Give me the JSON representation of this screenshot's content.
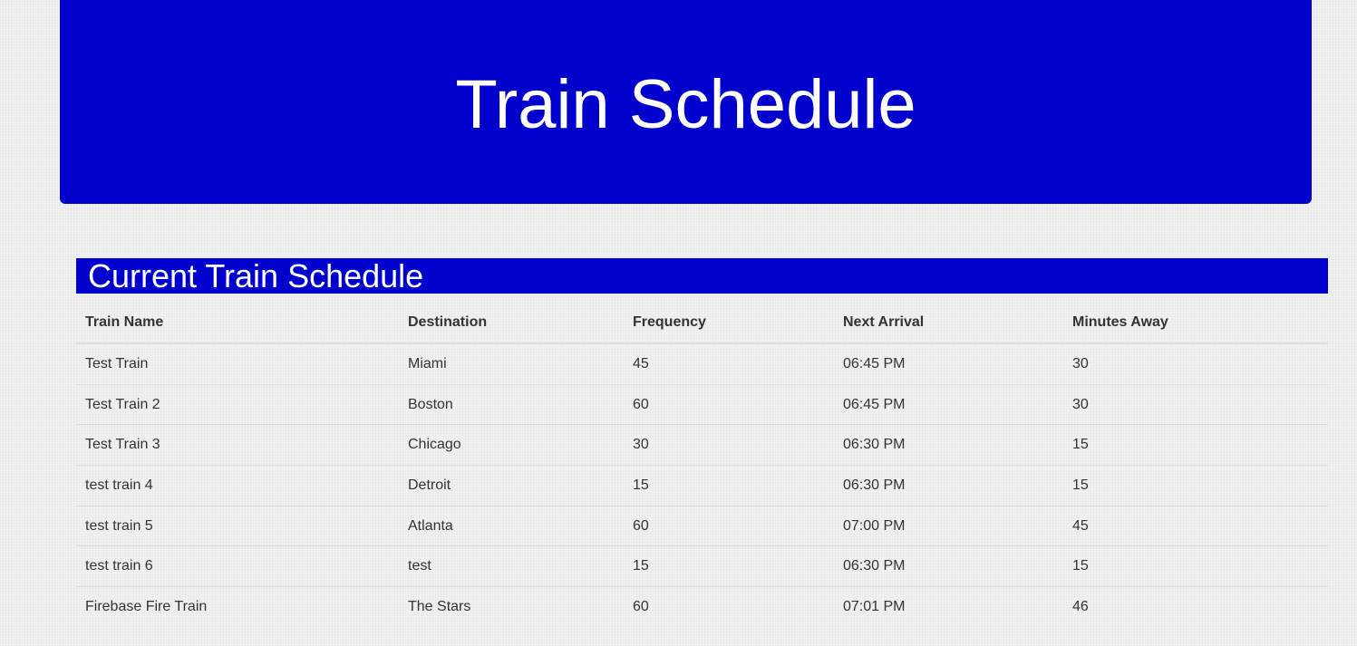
{
  "header": {
    "title": "Train Schedule"
  },
  "schedule": {
    "heading": "Current Train Schedule",
    "columns": [
      "Train Name",
      "Destination",
      "Frequency",
      "Next Arrival",
      "Minutes Away"
    ],
    "rows": [
      [
        "Test Train",
        "Miami",
        "45",
        "06:45 PM",
        "30"
      ],
      [
        "Test Train 2",
        "Boston",
        "60",
        "06:45 PM",
        "30"
      ],
      [
        "Test Train 3",
        "Chicago",
        "30",
        "06:30 PM",
        "15"
      ],
      [
        "test train 4",
        "Detroit",
        "15",
        "06:30 PM",
        "15"
      ],
      [
        "test train 5",
        "Atlanta",
        "60",
        "07:00 PM",
        "45"
      ],
      [
        "test train 6",
        "test",
        "15",
        "06:30 PM",
        "15"
      ],
      [
        "Firebase Fire Train",
        "The Stars",
        "60",
        "07:01 PM",
        "46"
      ]
    ]
  },
  "colors": {
    "header_bg": "#0000cc",
    "page_bg": "#f1f1f1",
    "text": "#333333"
  }
}
